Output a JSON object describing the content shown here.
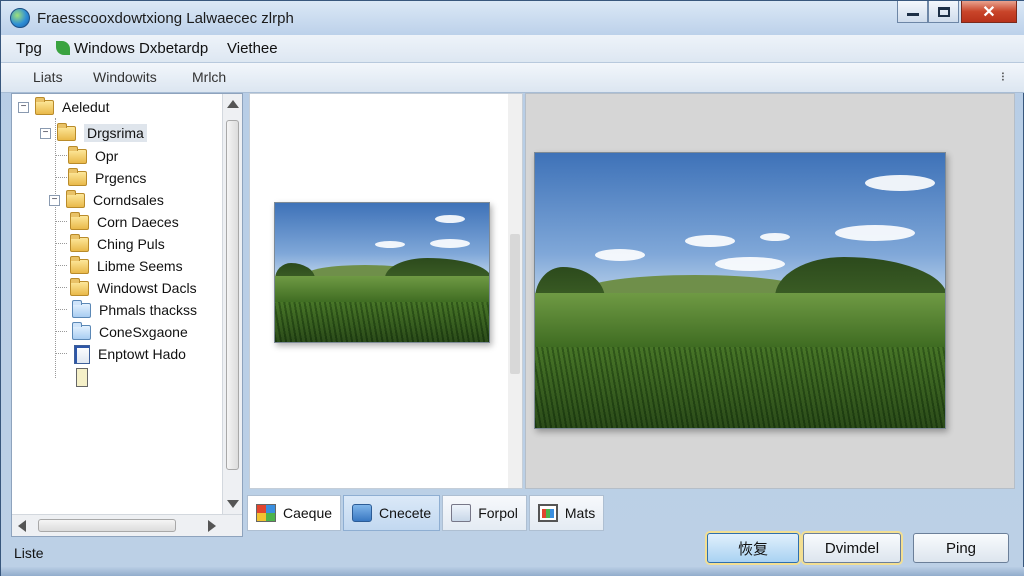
{
  "window": {
    "title": "Fraesscooxdowtxiong Lalwaecec zlrph"
  },
  "menu": {
    "items": [
      "Tpg",
      "Windows Dxbetardp",
      "Viethee"
    ]
  },
  "toolbar": {
    "items": [
      "Liats",
      "Windowits",
      "Mrlch"
    ],
    "extra": "⁝"
  },
  "tree": {
    "items": [
      {
        "label": "Aeledut",
        "icon": "folder-icon"
      },
      {
        "label": "Drgsrima",
        "icon": "folder-icon"
      },
      {
        "label": "Opr",
        "icon": "folder-icon"
      },
      {
        "label": "Prgencs",
        "icon": "folder-icon"
      },
      {
        "label": "Corndsales",
        "icon": "folder-icon"
      },
      {
        "label": "Corn Daeces",
        "icon": "folder-icon"
      },
      {
        "label": "Ching Puls",
        "icon": "folder-icon"
      },
      {
        "label": "Libme Seems",
        "icon": "folder-icon"
      },
      {
        "label": "Windowst Dacls",
        "icon": "folder-icon"
      },
      {
        "label": "Phmals thackss",
        "icon": "network-folder-icon"
      },
      {
        "label": "ConeSxgaone",
        "icon": "network-folder-icon"
      },
      {
        "label": "Enptowt Hado",
        "icon": "document-icon"
      }
    ]
  },
  "tabs": [
    {
      "label": "Caeque",
      "icon": "windows-grid-icon"
    },
    {
      "label": "Cnecete",
      "icon": "sync-arrow-icon"
    },
    {
      "label": "Forpol",
      "icon": "folder-tab-icon"
    },
    {
      "label": "Mats",
      "icon": "chart-icon"
    }
  ],
  "status": {
    "text": "Liste"
  },
  "buttons": {
    "primary": "恢复",
    "second": "Dvimdel",
    "third": "Ping"
  }
}
